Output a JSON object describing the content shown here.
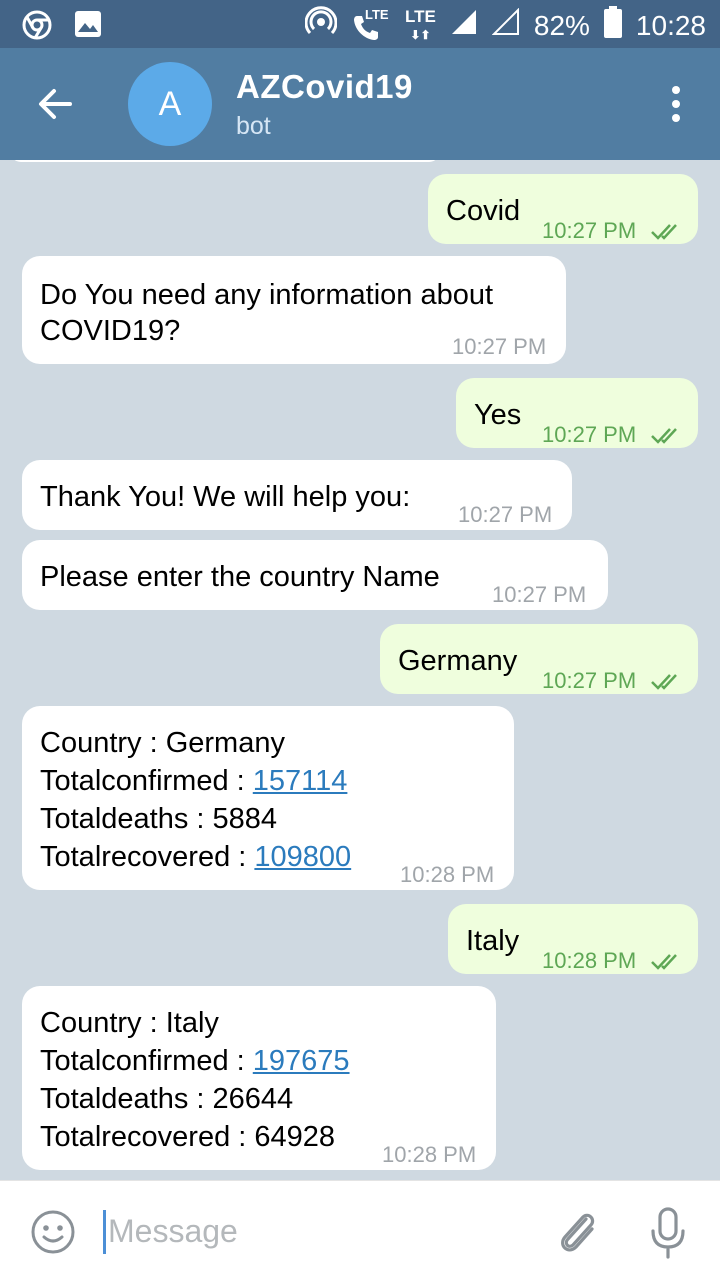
{
  "status_bar": {
    "icons_left": [
      "chrome-icon",
      "gallery-icon"
    ],
    "lte1": "LTE",
    "lte2": "LTE",
    "battery": "82%",
    "time": "10:28"
  },
  "header": {
    "avatar_letter": "A",
    "title": "AZCovid19",
    "subtitle": "bot"
  },
  "messages": [
    {
      "side": "out",
      "text": "Covid",
      "time": "10:27 PM"
    },
    {
      "side": "in",
      "lines": [
        "Do You need any information about",
        "COVID19?"
      ],
      "time": "10:27 PM"
    },
    {
      "side": "out",
      "text": "Yes",
      "time": "10:27 PM"
    },
    {
      "side": "in",
      "text": "Thank You! We will help you:",
      "time": "10:27 PM"
    },
    {
      "side": "in",
      "text": "Please enter the country Name",
      "time": "10:27 PM"
    },
    {
      "side": "out",
      "text": "Germany",
      "time": "10:27 PM"
    },
    {
      "side": "in",
      "stats": {
        "country_label": "Country : ",
        "country": "Germany",
        "confirmed_label": "Totalconfirmed : ",
        "confirmed": "157114",
        "deaths_label": "Totaldeaths : ",
        "deaths": "5884",
        "recovered_label": "Totalrecovered : ",
        "recovered": "109800"
      },
      "time": "10:28 PM"
    },
    {
      "side": "out",
      "text": "Italy",
      "time": "10:28 PM"
    },
    {
      "side": "in",
      "stats": {
        "country_label": "Country : ",
        "country": "Italy",
        "confirmed_label": "Totalconfirmed : ",
        "confirmed": "197675",
        "deaths_label": "Totaldeaths : ",
        "deaths": "26644",
        "recovered_label": "Totalrecovered : ",
        "recovered": "64928"
      },
      "time": "10:28 PM"
    }
  ],
  "input": {
    "placeholder": "Message"
  },
  "colors": {
    "header": "#517da2",
    "status_bar": "#436487",
    "incoming": "#ffffff",
    "outgoing": "#effedd",
    "link": "#2b7bbd"
  }
}
